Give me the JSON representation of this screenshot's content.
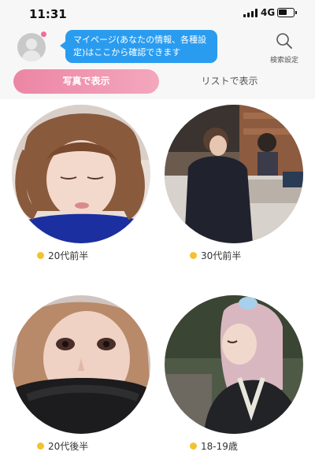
{
  "status_bar": {
    "time": "11:31",
    "network": "4G",
    "icons": [
      "signal-bars-icon",
      "battery-icon"
    ]
  },
  "header": {
    "avatar_icon": "default-avatar-icon",
    "tooltip_text": "マイページ(あなたの情報、各種設定)はここから確認できます",
    "search_icon": "search-icon",
    "search_label": "検索設定"
  },
  "tabs": [
    {
      "label": "写真で表示",
      "selected": true
    },
    {
      "label": "リストで表示",
      "selected": false
    }
  ],
  "profiles": [
    {
      "age": "20代前半",
      "photo_icon": "profile-photo",
      "status_color": "#f2c230"
    },
    {
      "age": "30代前半",
      "photo_icon": "profile-photo",
      "status_color": "#f2c230"
    },
    {
      "age": "20代後半",
      "photo_icon": "profile-photo",
      "status_color": "#f2c230"
    },
    {
      "age": "18-19歳",
      "photo_icon": "profile-photo",
      "status_color": "#f2c230"
    }
  ],
  "colors": {
    "accent_pink": "#ec86a4",
    "tooltip_blue": "#2a9cf0",
    "online_yellow": "#f2c230"
  }
}
